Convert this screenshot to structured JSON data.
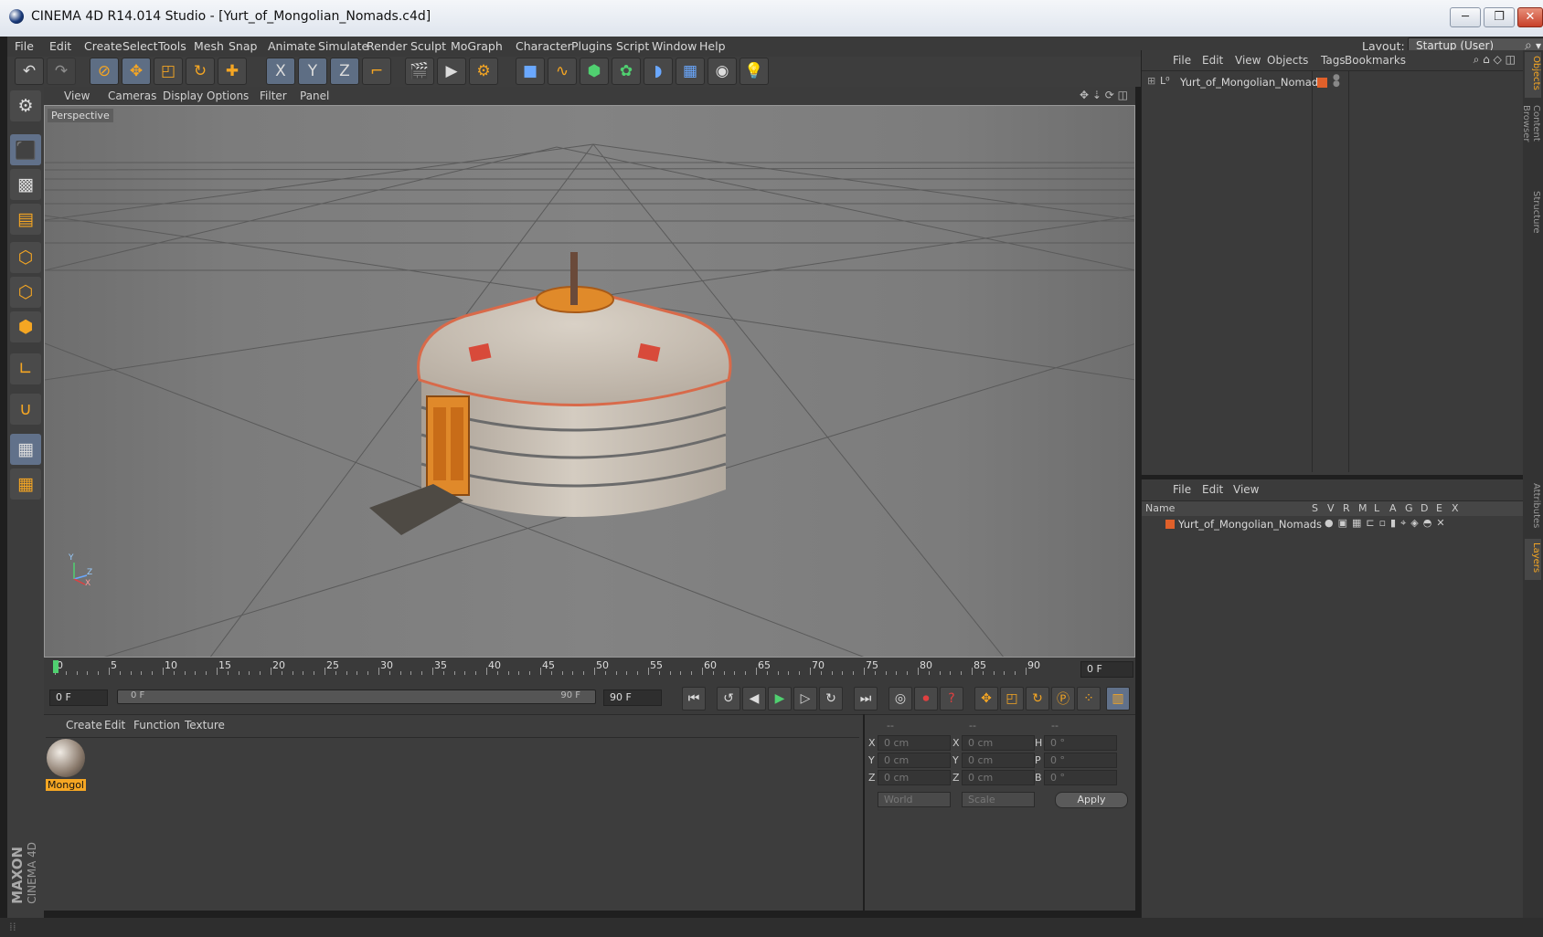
{
  "window": {
    "title": "CINEMA 4D R14.014 Studio - [Yurt_of_Mongolian_Nomads.c4d]",
    "min": "─",
    "restore": "❐",
    "close": "✕"
  },
  "menubar": {
    "items": [
      "File",
      "Edit",
      "Create",
      "Select",
      "Tools",
      "Mesh",
      "Snap",
      "Animate",
      "Simulate",
      "Render",
      "Sculpt",
      "MoGraph",
      "Character",
      "Plugins",
      "Script",
      "Window",
      "Help"
    ],
    "layout_label": "Layout:",
    "layout_value": "Startup (User)"
  },
  "toolbar": {
    "icons": [
      "undo-icon",
      "redo-icon",
      "live-select-icon",
      "move-icon",
      "scale-icon",
      "rotate-icon",
      "add-icon",
      "x-axis-icon",
      "y-axis-icon",
      "z-axis-icon",
      "coordinate-system-icon",
      "render-view-icon",
      "render-picture-viewer-icon",
      "render-settings-icon",
      "cube-icon",
      "spline-icon",
      "nurbs-icon",
      "array-icon",
      "deformer-icon",
      "floor-icon",
      "camera-icon",
      "light-icon"
    ],
    "x_label": "X",
    "y_label": "Y",
    "z_label": "Z"
  },
  "viewport": {
    "menu": [
      "View",
      "Cameras",
      "Display",
      "Options",
      "Filter",
      "Panel"
    ],
    "label": "Perspective",
    "axis_y": "Y",
    "axis_z": "Z",
    "axis_x": "X"
  },
  "timeline": {
    "ticks": [
      "0",
      "5",
      "10",
      "15",
      "20",
      "25",
      "30",
      "35",
      "40",
      "45",
      "50",
      "55",
      "60",
      "65",
      "70",
      "75",
      "80",
      "85",
      "90"
    ],
    "current_frame": "0 F",
    "start": "0 F",
    "range_start": "0 F",
    "range_end": "90 F",
    "end": "90 F"
  },
  "materials": {
    "menu": [
      "Create",
      "Edit",
      "Function",
      "Texture"
    ],
    "items": [
      {
        "name": "Mongol"
      }
    ]
  },
  "coordinates": {
    "headers": [
      "--",
      "--",
      "--"
    ],
    "rows": [
      {
        "a": "X",
        "av": "0 cm",
        "b": "X",
        "bv": "0 cm",
        "c": "H",
        "cv": "0 °"
      },
      {
        "a": "Y",
        "av": "0 cm",
        "b": "Y",
        "bv": "0 cm",
        "c": "P",
        "cv": "0 °"
      },
      {
        "a": "Z",
        "av": "0 cm",
        "b": "Z",
        "bv": "0 cm",
        "c": "B",
        "cv": "0 °"
      }
    ],
    "mode1": "World",
    "mode2": "Scale",
    "apply": "Apply"
  },
  "objects": {
    "menu": [
      "File",
      "Edit",
      "View",
      "Objects",
      "Tags",
      "Bookmarks"
    ],
    "items": [
      {
        "name": "Yurt_of_Mongolian_Nomads"
      }
    ]
  },
  "layers": {
    "menu": [
      "File",
      "Edit",
      "View"
    ],
    "columns": [
      "Name",
      "S",
      "V",
      "R",
      "M",
      "L",
      "A",
      "G",
      "D",
      "E",
      "X"
    ],
    "items": [
      {
        "name": "Yurt_of_Mongolian_Nomads"
      }
    ]
  },
  "sidetabs": [
    "Objects",
    "Content Browser",
    "Structure",
    "Attributes",
    "Layers"
  ],
  "logo": {
    "line1": "MAXON",
    "line2": "CINEMA 4D"
  },
  "colors": {
    "accent": "#f5a623",
    "selected": "#61718a",
    "layer_color": "#e0602a"
  }
}
